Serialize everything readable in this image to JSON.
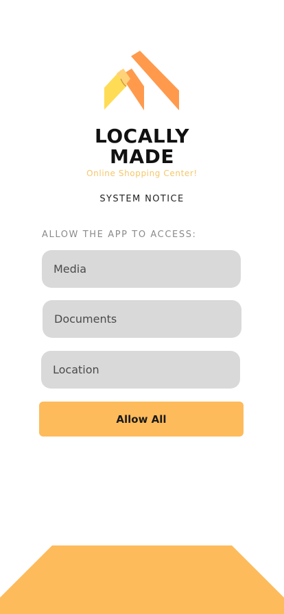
{
  "brand": {
    "title_line1": "LOCALLY",
    "title_line2": "MADE",
    "tagline": "Online Shopping Center!"
  },
  "notice": {
    "title": "SYSTEM NOTICE",
    "access_label": "ALLOW THE APP TO ACCESS:"
  },
  "permissions": [
    {
      "label": "Media"
    },
    {
      "label": "Documents"
    },
    {
      "label": "Location"
    }
  ],
  "actions": {
    "allow_all_label": "Allow All"
  },
  "colors": {
    "accent": "#fdbb5b",
    "logo_orange": "#ff9a4d",
    "logo_yellow": "#ffdc55",
    "field_bg": "#d9d9d9",
    "tagline": "#f5c76a"
  },
  "icons": {
    "logo": "house-roof-logo-icon"
  }
}
